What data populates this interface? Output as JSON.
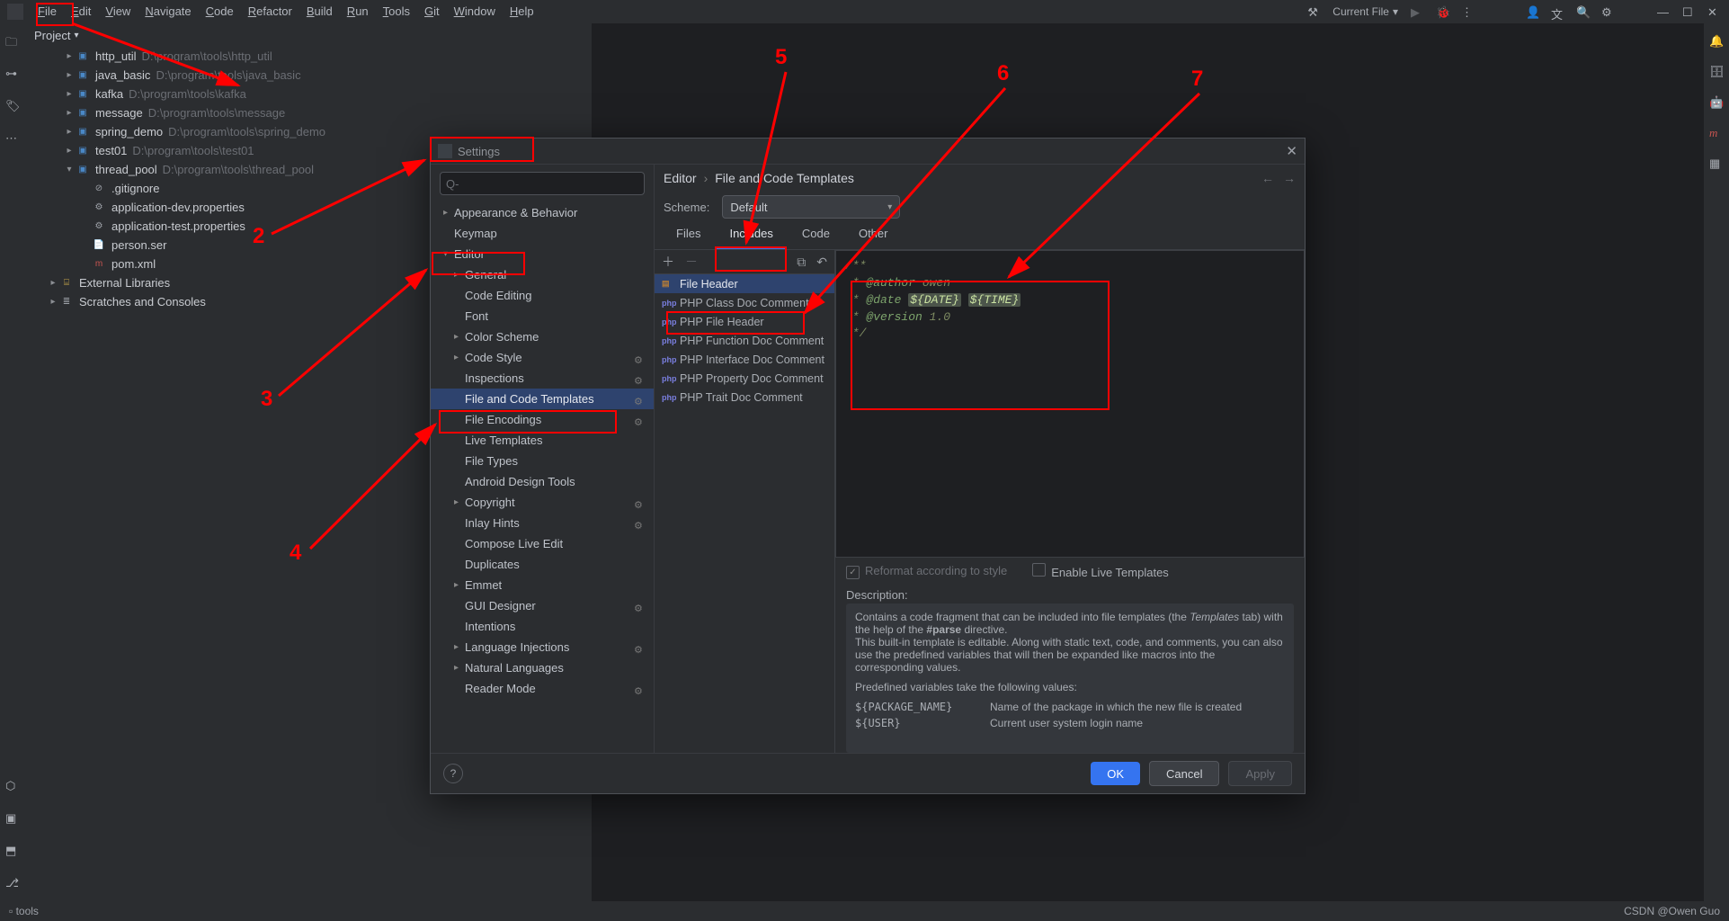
{
  "menubar": {
    "items": [
      "File",
      "Edit",
      "View",
      "Navigate",
      "Code",
      "Refactor",
      "Build",
      "Run",
      "Tools",
      "Git",
      "Window",
      "Help"
    ],
    "run_config": "Current File"
  },
  "project": {
    "title": "Project",
    "tree": [
      {
        "kind": "module",
        "arrow": ">",
        "name": "http_util",
        "path": "D:\\program\\tools\\http_util",
        "indent": 1
      },
      {
        "kind": "module",
        "arrow": ">",
        "name": "java_basic",
        "path": "D:\\program\\tools\\java_basic",
        "indent": 1
      },
      {
        "kind": "module",
        "arrow": ">",
        "name": "kafka",
        "path": "D:\\program\\tools\\kafka",
        "indent": 1
      },
      {
        "kind": "module",
        "arrow": ">",
        "name": "message",
        "path": "D:\\program\\tools\\message",
        "indent": 1
      },
      {
        "kind": "module",
        "arrow": ">",
        "name": "spring_demo",
        "path": "D:\\program\\tools\\spring_demo",
        "indent": 1
      },
      {
        "kind": "module",
        "arrow": ">",
        "name": "test01",
        "path": "D:\\program\\tools\\test01",
        "indent": 1
      },
      {
        "kind": "module",
        "arrow": "v",
        "name": "thread_pool",
        "path": "D:\\program\\tools\\thread_pool",
        "indent": 1
      },
      {
        "kind": "file",
        "name": ".gitignore",
        "indent": 2,
        "fico": "⊘"
      },
      {
        "kind": "file",
        "name": "application-dev.properties",
        "indent": 2,
        "fico": "⚙"
      },
      {
        "kind": "file",
        "name": "application-test.properties",
        "indent": 2,
        "fico": "⚙"
      },
      {
        "kind": "file",
        "name": "person.ser",
        "indent": 2,
        "fico": "📄"
      },
      {
        "kind": "file",
        "name": "pom.xml",
        "indent": 2,
        "fico": "m",
        "ficoColor": "#c75450"
      },
      {
        "kind": "lib",
        "arrow": ">",
        "name": "External Libraries",
        "indent": 0
      },
      {
        "kind": "scratch",
        "arrow": ">",
        "name": "Scratches and Consoles",
        "indent": 0
      }
    ]
  },
  "dialog": {
    "title": "Settings",
    "search_placeholder": "Q-",
    "breadcrumbs": [
      "Editor",
      "File and Code Templates"
    ],
    "scheme_label": "Scheme:",
    "scheme_value": "Default",
    "settings_tree": [
      {
        "label": "Appearance & Behavior",
        "lvl": 0,
        "arrow": ">"
      },
      {
        "label": "Keymap",
        "lvl": 0
      },
      {
        "label": "Editor",
        "lvl": 0,
        "arrow": "v"
      },
      {
        "label": "General",
        "lvl": 1,
        "arrow": ">"
      },
      {
        "label": "Code Editing",
        "lvl": 1
      },
      {
        "label": "Font",
        "lvl": 1
      },
      {
        "label": "Color Scheme",
        "lvl": 1,
        "arrow": ">"
      },
      {
        "label": "Code Style",
        "lvl": 1,
        "arrow": ">",
        "gear": true
      },
      {
        "label": "Inspections",
        "lvl": 1,
        "gear": true
      },
      {
        "label": "File and Code Templates",
        "lvl": 1,
        "sel": true,
        "gear": true
      },
      {
        "label": "File Encodings",
        "lvl": 1,
        "gear": true
      },
      {
        "label": "Live Templates",
        "lvl": 1
      },
      {
        "label": "File Types",
        "lvl": 1
      },
      {
        "label": "Android Design Tools",
        "lvl": 1
      },
      {
        "label": "Copyright",
        "lvl": 1,
        "arrow": ">",
        "gear": true
      },
      {
        "label": "Inlay Hints",
        "lvl": 1,
        "gear": true
      },
      {
        "label": "Compose Live Edit",
        "lvl": 1
      },
      {
        "label": "Duplicates",
        "lvl": 1
      },
      {
        "label": "Emmet",
        "lvl": 1,
        "arrow": ">"
      },
      {
        "label": "GUI Designer",
        "lvl": 1,
        "gear": true
      },
      {
        "label": "Intentions",
        "lvl": 1
      },
      {
        "label": "Language Injections",
        "lvl": 1,
        "arrow": ">",
        "gear": true
      },
      {
        "label": "Natural Languages",
        "lvl": 1,
        "arrow": ">"
      },
      {
        "label": "Reader Mode",
        "lvl": 1,
        "gear": true
      }
    ],
    "tabs": [
      "Files",
      "Includes",
      "Code",
      "Other"
    ],
    "active_tab": 1,
    "toolbar_icons": [
      "add",
      "remove",
      "copy",
      "undo"
    ],
    "template_list": [
      {
        "icon": "gen",
        "label": "File Header",
        "sel": true
      },
      {
        "icon": "php",
        "label": "PHP Class Doc Comment"
      },
      {
        "icon": "php",
        "label": "PHP File Header"
      },
      {
        "icon": "php",
        "label": "PHP Function Doc Comment"
      },
      {
        "icon": "php",
        "label": "PHP Interface Doc Comment"
      },
      {
        "icon": "php",
        "label": "PHP Property Doc Comment"
      },
      {
        "icon": "php",
        "label": "PHP Trait Doc Comment"
      }
    ],
    "code": {
      "l1": "/**",
      "l2_a": " * ",
      "l2_b": "@author",
      "l2_c": " owen",
      "l3_a": " * ",
      "l3_b": "@date",
      "l3_c": " ",
      "l3_d": "${DATE}",
      "l3_e": " ",
      "l3_f": "${TIME}",
      "l4_a": " * ",
      "l4_b": "@version",
      "l4_c": " 1.0",
      "l5": " */"
    },
    "reformat_label": "Reformat according to style",
    "live_templates_label": "Enable Live Templates",
    "description_label": "Description:",
    "description": {
      "p1a": "Contains a code fragment that can be included into file templates (the ",
      "p1b": "Templates",
      "p1c": " tab) with the help of the ",
      "p1d": "#parse",
      "p1e": " directive.",
      "p2": "This built-in template is editable. Along with static text, code, and comments, you can also use the predefined variables that will then be expanded like macros into the corresponding values.",
      "p3": "Predefined variables take the following values:",
      "var1_name": "${PACKAGE_NAME}",
      "var1_desc": "Name of the package in which the new file is created",
      "var2_name": "${USER}",
      "var2_desc": "Current user system login name"
    },
    "buttons": {
      "ok": "OK",
      "cancel": "Cancel",
      "apply": "Apply"
    }
  },
  "status": {
    "left": "▫ tools",
    "right": "CSDN @Owen Guo"
  },
  "annotations": {
    "numbers": {
      "n2": "2",
      "n3": "3",
      "n4": "4",
      "n5": "5",
      "n6": "6",
      "n7": "7"
    }
  }
}
